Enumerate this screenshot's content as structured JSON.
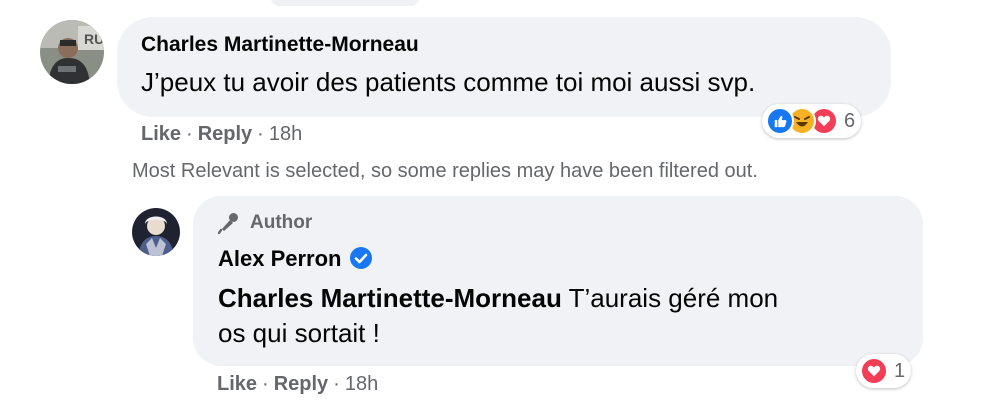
{
  "comment": {
    "author": "Charles Martinette-Morneau",
    "text": "J’peux tu avoir des patients comme toi moi aussi svp.",
    "actions": {
      "like": "Like",
      "reply": "Reply",
      "time": "18h"
    },
    "reactions": {
      "icons": [
        "like-icon",
        "haha-icon",
        "love-icon"
      ],
      "count": "6"
    }
  },
  "filter_note": "Most Relevant is selected, so some replies may have been filtered out.",
  "reply": {
    "badge": "Author",
    "author": "Alex Perron",
    "mention": "Charles Martinette-Morneau",
    "text_line1_rest": " T’aurais géré mon",
    "text_line2": "os qui sortait !",
    "actions": {
      "like": "Like",
      "reply": "Reply",
      "time": "18h"
    },
    "reactions": {
      "icons": [
        "love-icon"
      ],
      "count": "1"
    }
  },
  "colors": {
    "bubble_bg": "#f0f2f5",
    "secondary_text": "#65676b",
    "like_blue": "#1877f2",
    "love_red": "#f33e58",
    "haha_yellow": "#f7b125"
  }
}
